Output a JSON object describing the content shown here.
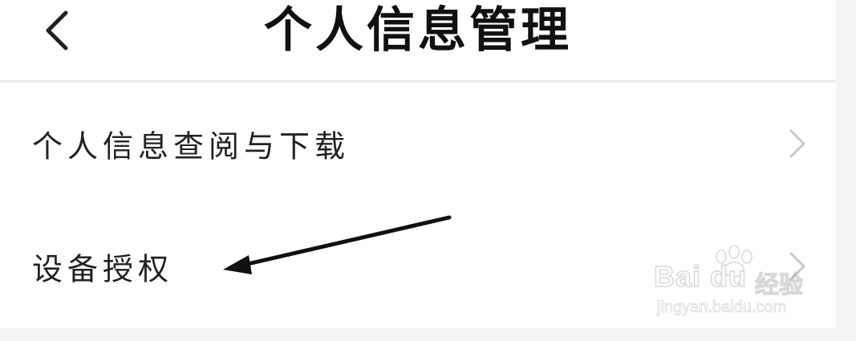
{
  "header": {
    "title": "个人信息管理",
    "back_icon": "chevron-left-icon"
  },
  "menu": {
    "items": [
      {
        "label": "个人信息查阅与下载",
        "icon": "chevron-right-icon"
      },
      {
        "label": "设备授权",
        "icon": "chevron-right-icon"
      }
    ]
  },
  "watermark": {
    "logo": "Bai du",
    "brand": "经验",
    "url": "jingyan.baidu.com"
  },
  "colors": {
    "background": "#ffffff",
    "side_strip": "#f4f4f6",
    "divider": "#ececec",
    "chevron": "#c8c8c8",
    "text": "#222222",
    "annotation_arrow": "#111111"
  }
}
